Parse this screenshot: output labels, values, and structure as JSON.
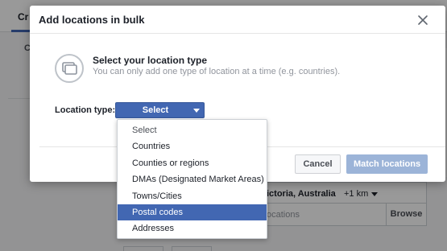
{
  "background": {
    "tab_label": "Cr",
    "sub_label": "C",
    "location_row": {
      "text": "ictoria, Australia",
      "radius": "+1 km"
    },
    "input_row": {
      "placeholder": "ocations",
      "browse_label": "Browse"
    }
  },
  "dialog": {
    "title": "Add locations in bulk",
    "close_icon": "close-icon",
    "type_icon": "duplicate-pages-icon",
    "heading": "Select your location type",
    "description": "You can only add one type of location at a time (e.g. countries).",
    "location_type_label": "Location type:",
    "select": {
      "value": "Select"
    },
    "buttons": {
      "cancel": "Cancel",
      "match": "Match locations"
    }
  },
  "menu": {
    "items": [
      {
        "label": "Select",
        "selected": false
      },
      {
        "label": "Countries",
        "selected": false
      },
      {
        "label": "Counties or regions",
        "selected": false
      },
      {
        "label": "DMAs (Designated Market Areas)",
        "selected": false
      },
      {
        "label": "Towns/Cities",
        "selected": false
      },
      {
        "label": "Postal codes",
        "selected": true
      },
      {
        "label": "Addresses",
        "selected": false
      }
    ]
  },
  "colors": {
    "primary": "#4267b2",
    "primary_disabled": "#9cb4d8",
    "overlay": "rgba(0,0,0,0.4)"
  }
}
